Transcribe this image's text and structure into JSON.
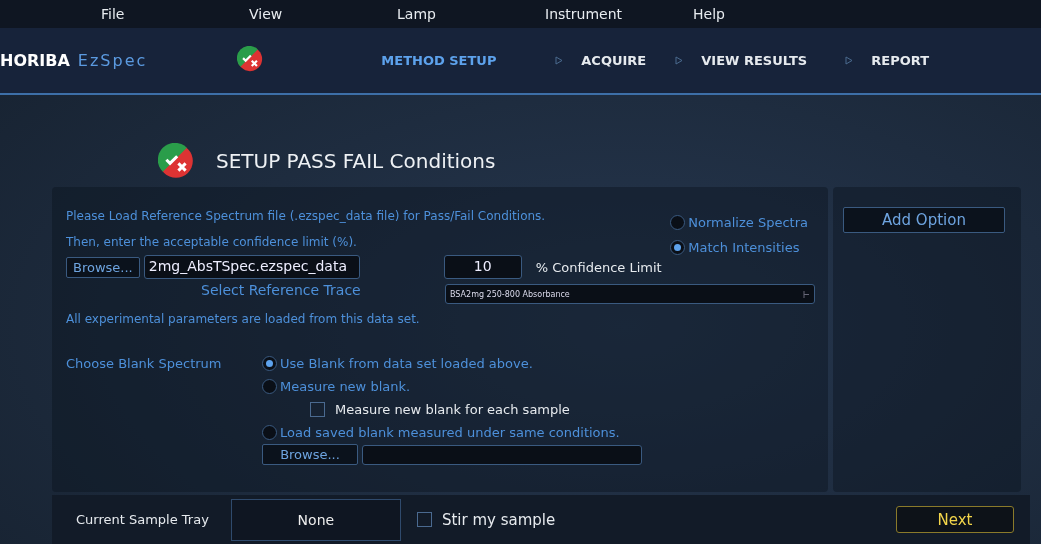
{
  "menu": [
    "File",
    "View",
    "Lamp",
    "Instrument",
    "Help"
  ],
  "brand": {
    "name": "HORIBA",
    "product": "EzSpec"
  },
  "steps": [
    {
      "label": "METHOD SETUP",
      "selected": true
    },
    {
      "label": "ACQUIRE",
      "selected": false
    },
    {
      "label": "VIEW RESULTS",
      "selected": false
    },
    {
      "label": "REPORT",
      "selected": false
    }
  ],
  "title": "SETUP PASS FAIL Conditions",
  "reference": {
    "intro": [
      "Please Load Reference Spectrum file (.ezspec_data file) for Pass/Fail Conditions.",
      "Then, enter the acceptable confidence limit (%)."
    ],
    "scaling": [
      {
        "label": "Normalize Spectra",
        "selected": false
      },
      {
        "label": "Match Intensities",
        "selected": true
      }
    ],
    "browse": "Browse...",
    "file": "2mg_AbsTSpec.ezspec_data",
    "confidence": "10",
    "confidence_label": "% Confidence Limit",
    "trace_label": "Select Reference Trace",
    "trace": "BSA2mg 250-800 Absorbance",
    "note": "All experimental parameters are loaded from this data set."
  },
  "blank": {
    "label": "Choose Blank Spectrum",
    "options": [
      {
        "kind": "radio",
        "label": "Use Blank from data set loaded above.",
        "selected": true
      },
      {
        "kind": "radio",
        "label": "Measure new blank.",
        "selected": false
      },
      {
        "kind": "checkbox",
        "label": "Measure new blank for each sample",
        "checked": false
      },
      {
        "kind": "radio",
        "label": "Load saved blank measured under same conditions.",
        "selected": false
      }
    ],
    "browse": "Browse..."
  },
  "add_option": "Add Option",
  "footer": {
    "tray_label": "Current Sample Tray",
    "tray": "None",
    "stir": {
      "label": "Stir my sample",
      "checked": false
    },
    "next": "Next"
  }
}
